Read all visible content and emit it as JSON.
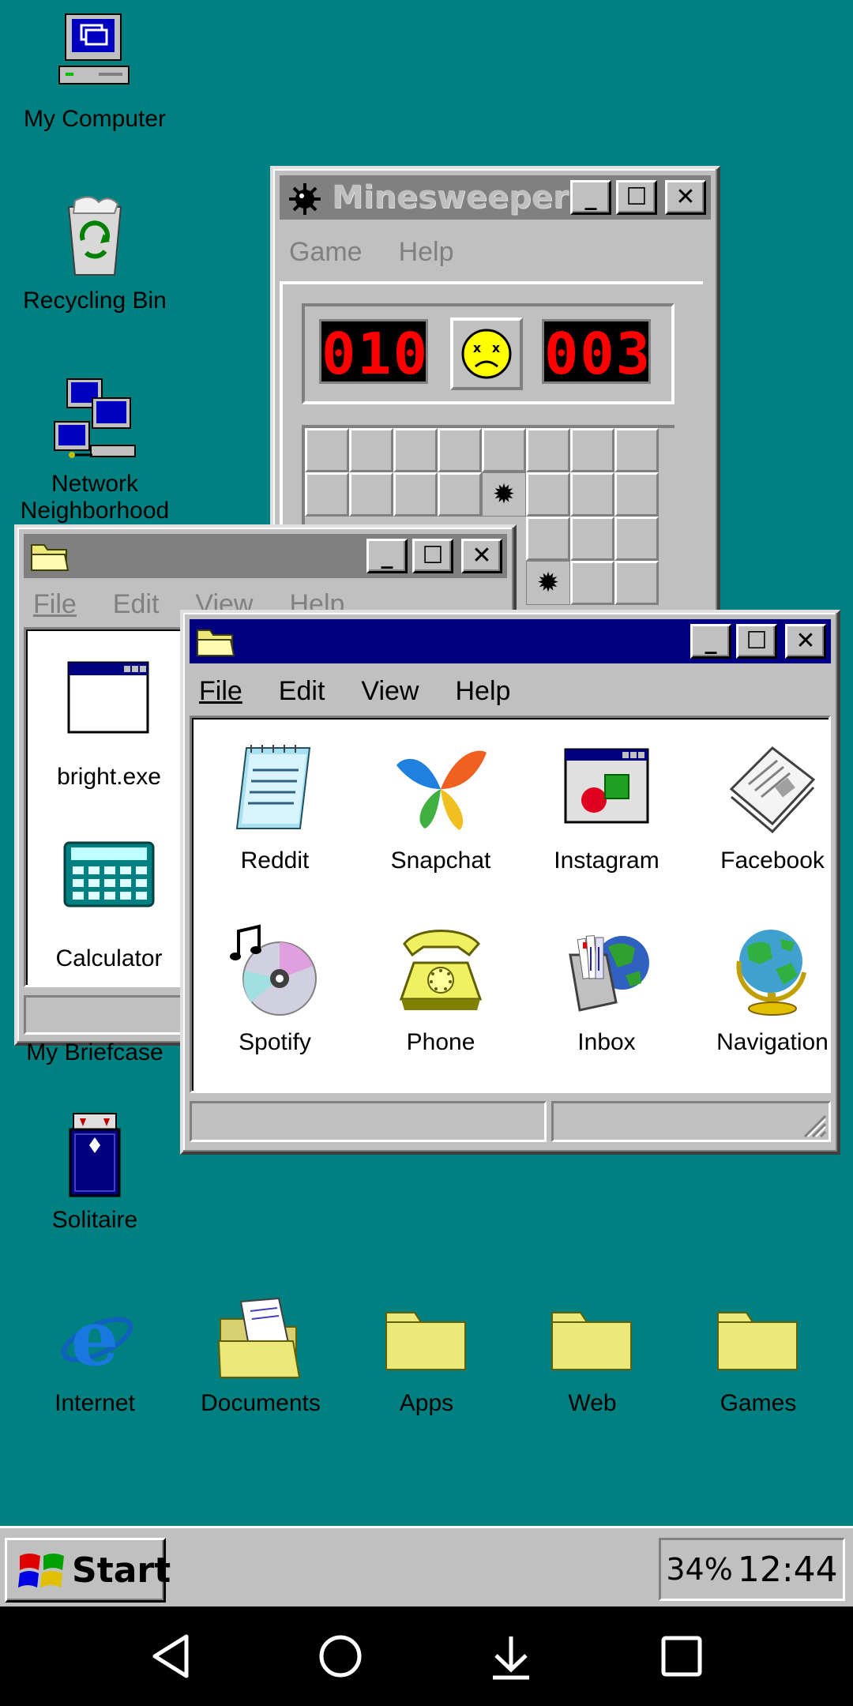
{
  "desktop": {
    "icons_left": [
      {
        "label": "My Computer"
      },
      {
        "label": "Recycling Bin"
      },
      {
        "label": "Network Neighborhood"
      },
      {
        "label": "My Briefcase"
      },
      {
        "label": "Solitaire"
      }
    ],
    "icons_bottom": [
      {
        "label": "Internet"
      },
      {
        "label": "Documents"
      },
      {
        "label": "Apps"
      },
      {
        "label": "Web"
      },
      {
        "label": "Games"
      }
    ]
  },
  "minesweeper": {
    "title": "Minesweeper",
    "menu": [
      "Game",
      "Help"
    ],
    "mine_counter": "010",
    "timer": "003",
    "face": "sad"
  },
  "explorer_back": {
    "menu": [
      "File",
      "Edit",
      "View",
      "Help"
    ],
    "items": [
      {
        "label": "bright.exe"
      },
      {
        "label": "Calculator"
      }
    ]
  },
  "explorer_front": {
    "menu": [
      "File",
      "Edit",
      "View",
      "Help"
    ],
    "items": [
      {
        "label": "Reddit",
        "icon": "notepad-icon"
      },
      {
        "label": "Snapchat",
        "icon": "butterfly-icon"
      },
      {
        "label": "Instagram",
        "icon": "shapes-window-icon"
      },
      {
        "label": "Facebook",
        "icon": "newspaper-icon"
      },
      {
        "label": "Spotify",
        "icon": "cd-music-icon"
      },
      {
        "label": "Phone",
        "icon": "telephone-icon"
      },
      {
        "label": "Inbox",
        "icon": "mail-inbox-icon"
      },
      {
        "label": "Navigation",
        "icon": "globe-icon"
      }
    ]
  },
  "taskbar": {
    "start_label": "Start",
    "battery": "34%",
    "clock": "12:44"
  },
  "colors": {
    "desktop": "#008080",
    "titlebar_active": "#000080",
    "window_face": "#c0c0c0",
    "folder_yellow": "#ece87a"
  }
}
